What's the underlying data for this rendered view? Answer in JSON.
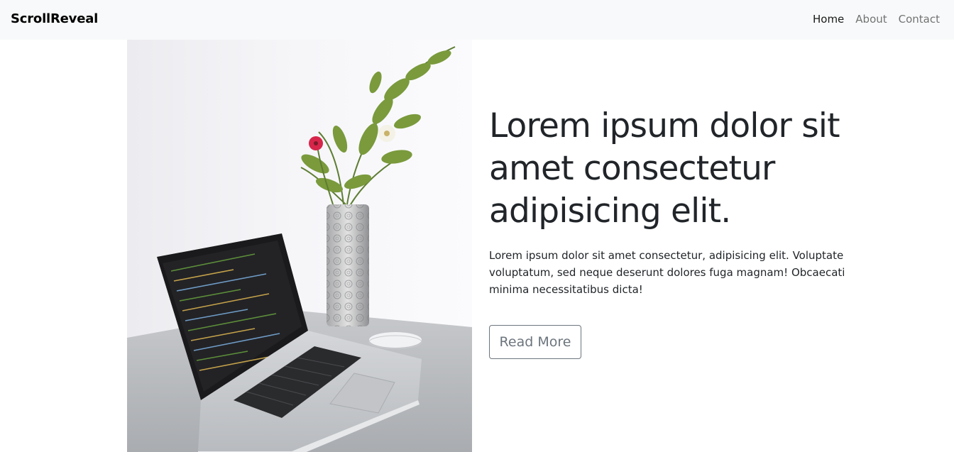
{
  "navbar": {
    "brand": "ScrollReveal",
    "links": [
      {
        "label": "Home",
        "active": true
      },
      {
        "label": "About",
        "active": false
      },
      {
        "label": "Contact",
        "active": false
      }
    ]
  },
  "hero": {
    "headline": "Lorem ipsum dolor sit amet consectetur adipisicing elit.",
    "paragraph": "Lorem ipsum dolor sit amet consectetur, adipisicing elit. Voluptate voluptatum, sed neque deserunt dolores fuga magnam! Obcaecati minima necessitatibus dicta!",
    "button_label": "Read More"
  },
  "colors": {
    "navbar_bg": "#f8f9fa",
    "text": "#212529",
    "button_outline": "#6c757d"
  },
  "image": {
    "icon": "laptop-and-flower-vase-photo"
  }
}
